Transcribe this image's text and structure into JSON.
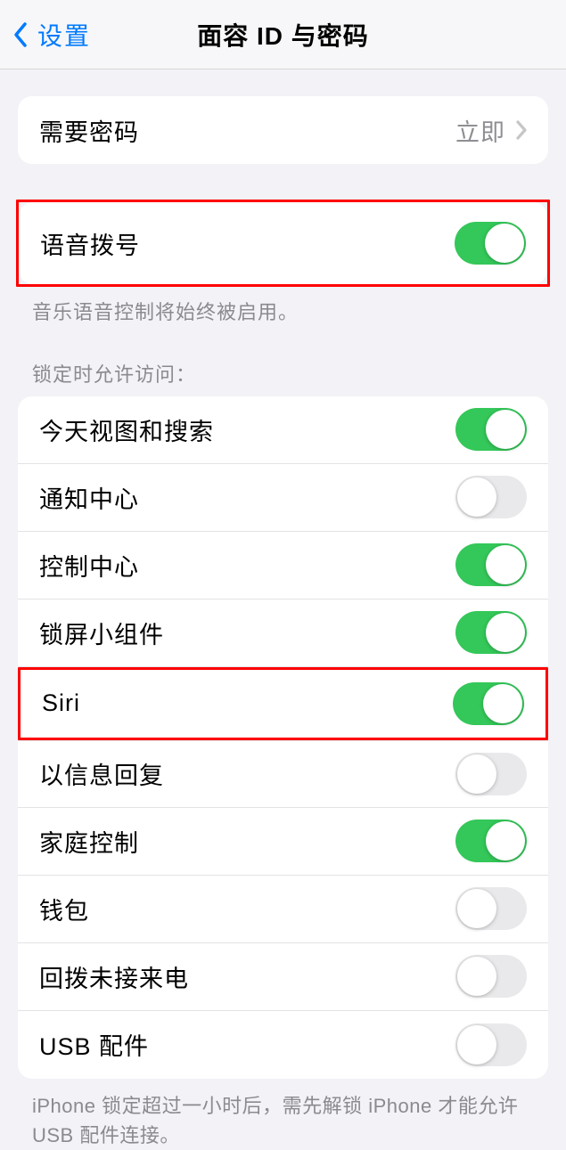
{
  "nav": {
    "back_label": "设置",
    "title": "面容 ID 与密码"
  },
  "group1": {
    "require_passcode": {
      "label": "需要密码",
      "value": "立即"
    }
  },
  "group2": {
    "voice_dial": {
      "label": "语音拨号"
    },
    "footer": "音乐语音控制将始终被启用。"
  },
  "group3": {
    "header": "锁定时允许访问：",
    "items": {
      "today": {
        "label": "今天视图和搜索"
      },
      "notification": {
        "label": "通知中心"
      },
      "control": {
        "label": "控制中心"
      },
      "widgets": {
        "label": "锁屏小组件"
      },
      "siri": {
        "label": "Siri"
      },
      "reply": {
        "label": "以信息回复"
      },
      "home": {
        "label": "家庭控制"
      },
      "wallet": {
        "label": "钱包"
      },
      "callback": {
        "label": "回拨未接来电"
      },
      "usb": {
        "label": "USB 配件"
      }
    },
    "footer": "iPhone 锁定超过一小时后，需先解锁 iPhone 才能允许USB 配件连接。"
  }
}
